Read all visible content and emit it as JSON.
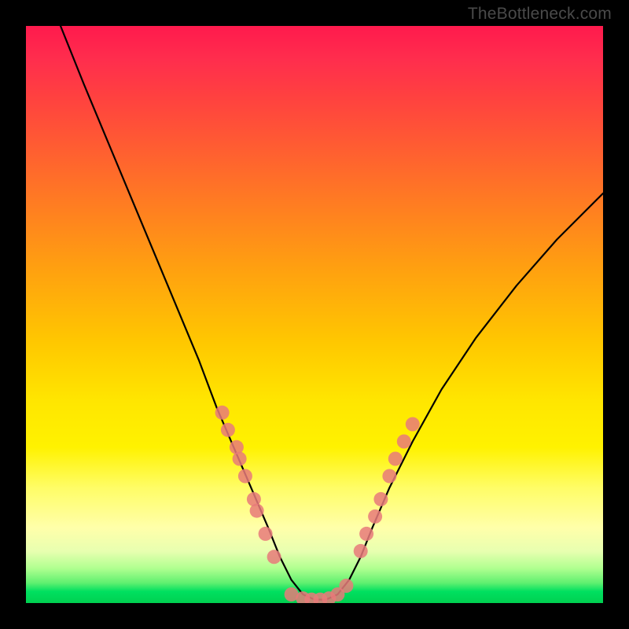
{
  "watermark": "TheBottleneck.com",
  "chart_data": {
    "type": "line",
    "title": "",
    "xlabel": "",
    "ylabel": "",
    "xlim": [
      0,
      100
    ],
    "ylim": [
      0,
      100
    ],
    "curve": {
      "name": "bottleneck-curve",
      "x": [
        6,
        10,
        15,
        20,
        25,
        30,
        33,
        36,
        39,
        42,
        44,
        46,
        48,
        50,
        52,
        54,
        56,
        58,
        60,
        63,
        67,
        72,
        78,
        85,
        92,
        100
      ],
      "y": [
        100,
        90,
        78,
        66,
        54,
        42,
        34,
        27,
        20,
        13,
        8,
        4,
        1.5,
        0.6,
        0.6,
        1.5,
        4,
        8,
        13,
        20,
        28,
        37,
        46,
        55,
        63,
        71
      ]
    },
    "series": [
      {
        "name": "left-cluster-dots",
        "x": [
          34,
          35,
          36.5,
          37,
          38,
          39.5,
          40,
          41.5,
          43
        ],
        "y": [
          33,
          30,
          27,
          25,
          22,
          18,
          16,
          12,
          8
        ]
      },
      {
        "name": "bottom-cluster-dots",
        "x": [
          46,
          48,
          49.5,
          51,
          52.5,
          54,
          55.5
        ],
        "y": [
          1.5,
          0.8,
          0.6,
          0.6,
          0.8,
          1.5,
          3
        ]
      },
      {
        "name": "right-cluster-dots",
        "x": [
          58,
          59,
          60.5,
          61.5,
          63,
          64,
          65.5,
          67
        ],
        "y": [
          9,
          12,
          15,
          18,
          22,
          25,
          28,
          31
        ]
      }
    ],
    "background_gradient": {
      "top": "#ff1a4d",
      "mid": "#ffe600",
      "bottom": "#00d050"
    }
  }
}
